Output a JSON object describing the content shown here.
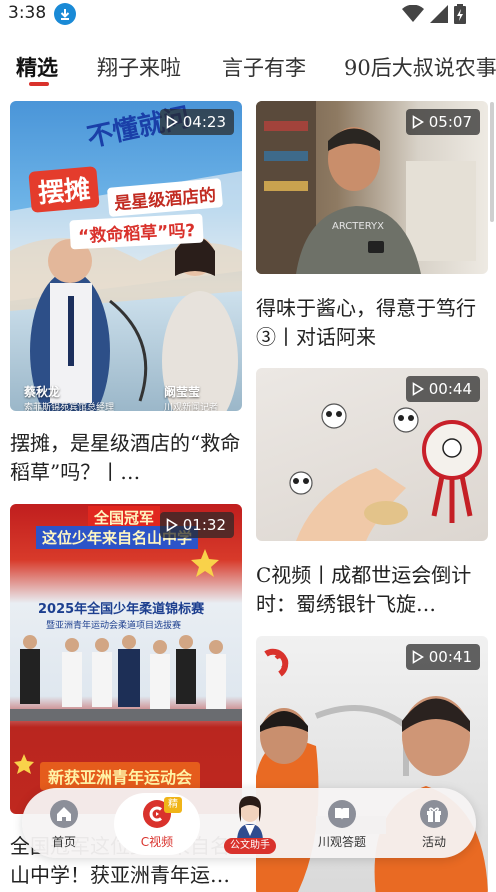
{
  "status_bar": {
    "time": "3:38"
  },
  "tabs": [
    {
      "label": "精选"
    },
    {
      "label": "翔子来啦"
    },
    {
      "label": "言子有李"
    },
    {
      "label": "90后大叔说农事"
    }
  ],
  "cards": [
    {
      "duration": "04:23",
      "title": "摆摊，是星级酒店的“救命稻草”吗？丨…",
      "thumb_text_1": "不懂就问",
      "thumb_text_2": "摆摊",
      "thumb_text_3": "是星级酒店的",
      "thumb_text_4": "“救命稻草”吗?",
      "person_1_name": "蔡秋龙",
      "person_1_role": "索菲斯锦苑宾馆总经理",
      "person_2_name": "阚莹莹",
      "person_2_role": "川观新闻记者"
    },
    {
      "duration": "05:07",
      "title": "得味于酱心，得意于笃行③丨对话阿来",
      "shirt_text": "ARCTERYX"
    },
    {
      "duration": "00:44",
      "title": "C视频丨成都世运会倒计时：蜀绣银针飞旋…"
    },
    {
      "duration": "01:32",
      "title": "全国冠军这位少年来自名山中学！获亚洲青年运动会柔…",
      "thumb_text_1": "全国冠军",
      "thumb_text_2": "这位少年来自名山中学",
      "thumb_text_3": "2025年全国少年柔道锦标赛",
      "thumb_text_4": "暨亚洲青年运动会柔道项目选拔赛",
      "thumb_text_5": "新获亚洲青年运动会"
    },
    {
      "duration": "00:41",
      "title": ""
    }
  ],
  "bottom_nav": {
    "items": [
      {
        "label": "首页",
        "icon": "home-icon"
      },
      {
        "label": "C视频",
        "icon": "c-video-icon"
      },
      {
        "label": "",
        "icon": "assistant-avatar"
      },
      {
        "label": "川观答题",
        "icon": "book-icon"
      },
      {
        "label": "活动",
        "icon": "gift-icon"
      }
    ],
    "hot_badge": "精",
    "assistant_label": "公文助手"
  },
  "colors": {
    "accent": "#d9322c",
    "nav_icon": "#8c8f99",
    "badge": "#f0b418"
  }
}
